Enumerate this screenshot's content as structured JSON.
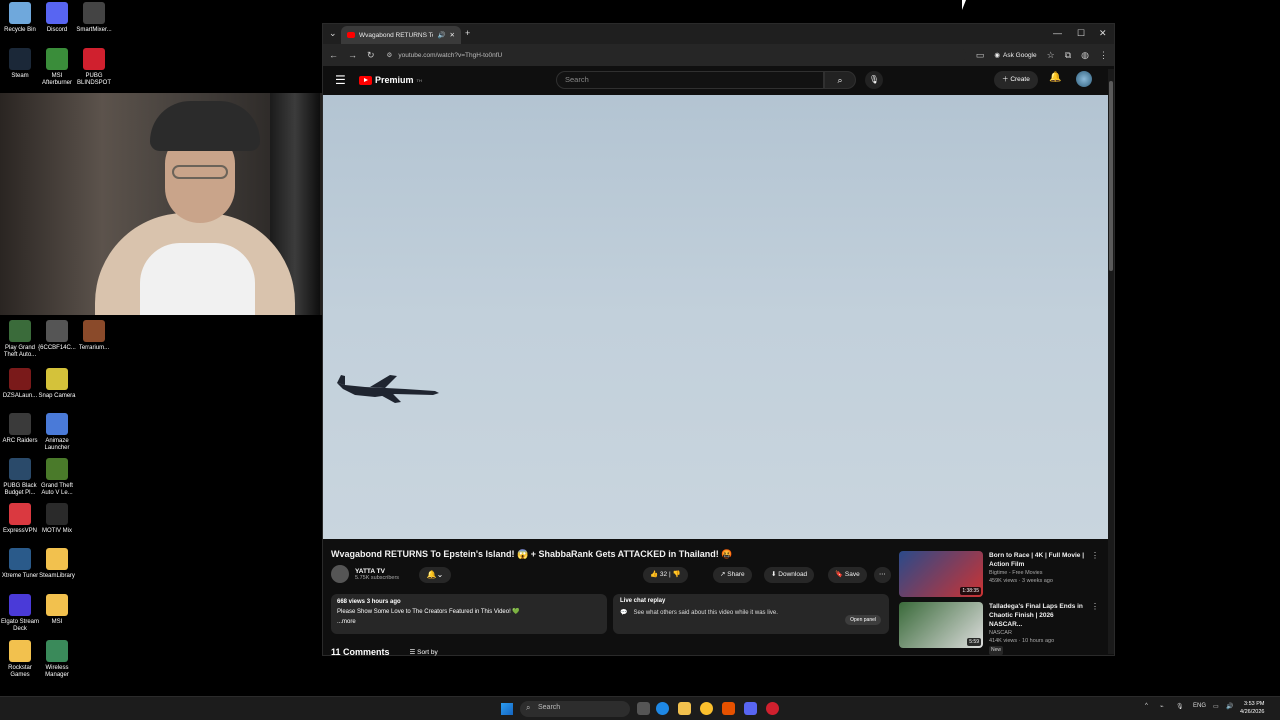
{
  "desktop": {
    "icons": [
      {
        "label": "Recycle Bin",
        "color": "#6fa8dc"
      },
      {
        "label": "Discord",
        "color": "#5865f2"
      },
      {
        "label": "SmartMixer...",
        "color": "#444444"
      },
      {
        "label": "Steam",
        "color": "#1b2838"
      },
      {
        "label": "MSI Afterburner",
        "color": "#3a8d3a"
      },
      {
        "label": "PUBG BLINDSPOT",
        "color": "#d0202e"
      },
      {
        "label": "Play Grand Theft Auto...",
        "color": "#3a6b3a"
      },
      {
        "label": "{6CCBF14C...",
        "color": "#555555"
      },
      {
        "label": "Terrarium...",
        "color": "#8a4a2a"
      },
      {
        "label": "DZSALaun...",
        "color": "#7a1a1a"
      },
      {
        "label": "Snap Camera",
        "color": "#d4c23a"
      },
      {
        "label": "ARC Raiders",
        "color": "#3a3a3a"
      },
      {
        "label": "Animaze Launcher",
        "color": "#4a7ad8"
      },
      {
        "label": "PUBG Black Budget Pl...",
        "color": "#2a4a6a"
      },
      {
        "label": "Grand Theft Auto V Le...",
        "color": "#4a7a2a"
      },
      {
        "label": "ExpressVPN",
        "color": "#da3940"
      },
      {
        "label": "MOTIV Mix",
        "color": "#2a2a2a"
      },
      {
        "label": "Xtreme Tuner",
        "color": "#2a5a8a"
      },
      {
        "label": "SteamLibrary",
        "color": "#f2c14e"
      },
      {
        "label": "Elgato Stream Deck",
        "color": "#4a3ad8"
      },
      {
        "label": "MSI",
        "color": "#f2c14e"
      },
      {
        "label": "Rockstar Games",
        "color": "#f2c14e"
      },
      {
        "label": "Wireless Manager",
        "color": "#3a8a5a"
      }
    ]
  },
  "browser": {
    "tab_title": "Wvagabond RETURNS To E...",
    "url": "youtube.com/watch?v=ThgH-to0nfU",
    "ask_google": "Ask Google",
    "new_tab": "+",
    "min": "—",
    "max": "☐",
    "close": "✕"
  },
  "youtube": {
    "logo_text": "Premium",
    "logo_sup": "TH",
    "search_placeholder": "Search",
    "create_label": "Create",
    "video_title": "Wvagabond RETURNS To Epstein's Island! 😱 + ShabbaRank Gets ATTACKED in Thailand! 🤬",
    "channel_name": "YATTA TV",
    "subscribers": "5.75K subscribers",
    "likes": "32",
    "share": "Share",
    "download": "Download",
    "save": "Save",
    "desc_meta": "668 views  3 hours ago",
    "desc_text": "Please Show Some Love to The Creators Featured in This Video! 💚",
    "desc_more": "...more",
    "chat_title": "Live chat replay",
    "chat_text": "See what others said about this video while it was live.",
    "chat_open": "Open panel",
    "comments_count": "11 Comments",
    "sort_by": "Sort by",
    "recommendations": [
      {
        "title": "Born to Race | 4K | Full Movie | Action Film",
        "channel": "Bigtime - Free Movies",
        "meta": "459K views · 3 weeks ago",
        "duration": "1:38:35",
        "thumb_color": "#2a4a8a",
        "badge": ""
      },
      {
        "title": "Talladega's Final Laps Ends in Chaotic Finish | 2026 NASCAR...",
        "channel": "NASCAR",
        "meta": "414K views · 10 hours ago",
        "duration": "5:59",
        "thumb_color": "#3a6a3a",
        "badge": "New"
      }
    ]
  },
  "taskbar": {
    "search_placeholder": "Search",
    "lang": "ENG",
    "time": "3:53 PM",
    "date": "4/26/2026"
  }
}
